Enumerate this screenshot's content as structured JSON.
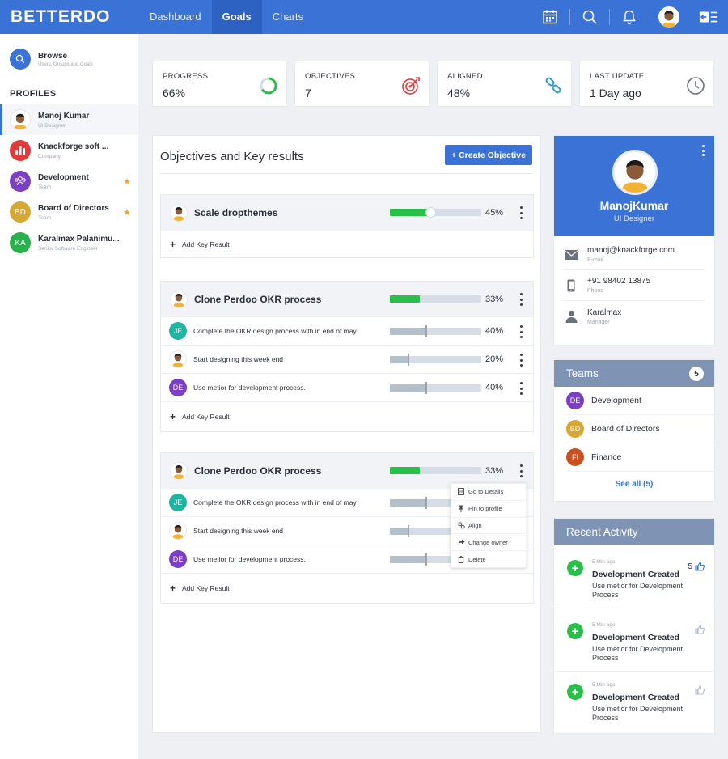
{
  "app": {
    "logo": "BETTERDO"
  },
  "nav": {
    "items": [
      {
        "label": "Dashboard"
      },
      {
        "label": "Goals"
      },
      {
        "label": "Charts"
      }
    ]
  },
  "sidebar": {
    "browse": {
      "title": "Browse",
      "subtitle": "Users, Groups and Goals"
    },
    "profiles_heading": "PROFILES",
    "profiles": [
      {
        "name": "Manoj Kumar",
        "sub": "UI Designer"
      },
      {
        "name": "Knackforge soft ...",
        "sub": "Company"
      },
      {
        "name": "Development",
        "sub": "Team"
      },
      {
        "name": "Board of Directors",
        "initials": "BD",
        "sub": "Team"
      },
      {
        "name": "Karalmax Palanimu...",
        "initials": "KA",
        "sub": "Senior Software Engineer"
      }
    ]
  },
  "stats": [
    {
      "label": "PROGRESS",
      "value": "66%"
    },
    {
      "label": "OBJECTIVES",
      "value": "7"
    },
    {
      "label": "ALIGNED",
      "value": "48%"
    },
    {
      "label": "LAST UPDATE",
      "value": "1 Day ago"
    }
  ],
  "objectives": {
    "title": "Objectives and Key results",
    "create_label": "+ Create Objective",
    "add_kr_label": "Add Key Result",
    "items": [
      {
        "name": "Scale dropthemes",
        "pct": "45%",
        "progress": 0.45,
        "key_results": []
      },
      {
        "name": "Clone Perdoo OKR process",
        "pct": "33%",
        "progress": 0.33,
        "key_results": [
          {
            "initials": "JE",
            "text": "Complete the OKR design process with in end of may",
            "pct": "40%",
            "progress": 0.4
          },
          {
            "initials": "",
            "text": "Start designing this week end",
            "pct": "20%",
            "progress": 0.2
          },
          {
            "initials": "DE",
            "text": "Use metior for development process.",
            "pct": "40%",
            "progress": 0.4
          }
        ]
      },
      {
        "name": "Clone Perdoo OKR process",
        "pct": "33%",
        "progress": 0.33,
        "key_results": [
          {
            "initials": "JE",
            "text": "Complete the OKR design process with in end of may",
            "progress": 0.4
          },
          {
            "initials": "",
            "text": "Start designing this week end",
            "progress": 0.2
          },
          {
            "initials": "DE",
            "text": "Use metior for development process.",
            "progress": 0.4
          }
        ]
      }
    ]
  },
  "context_menu": {
    "items": [
      "Go to Details",
      "Pin to profile",
      "Align",
      "Change owner",
      "Delete"
    ]
  },
  "profile_card": {
    "name": "ManojKumar",
    "role": "UI Designer",
    "email": "manoj@knackforge.com",
    "email_label": "E-mail",
    "phone": "+91 98402 13875",
    "phone_label": "Phone",
    "manager": "Karalmax",
    "manager_label": "Manager"
  },
  "teams": {
    "title": "Teams",
    "count": "5",
    "items": [
      {
        "initials": "DE",
        "name": "Development"
      },
      {
        "initials": "BD",
        "name": "Board of Directors"
      },
      {
        "initials": "FI",
        "name": "Finance"
      }
    ],
    "see_all": "See all (5)"
  },
  "recent_activity": {
    "title": "Recent Activity",
    "items": [
      {
        "time": "5 Min ago",
        "title": "Development Created",
        "desc": "Use metior for Development Process",
        "likes": "5"
      },
      {
        "time": "5 Min ago",
        "title": "Development Created",
        "desc": "Use metior for Development Process"
      },
      {
        "time": "5 Min ago",
        "title": "Development Created",
        "desc": "Use metior for Development Process"
      }
    ]
  },
  "colors": {
    "brand": "#3a72d6",
    "success": "#28c048",
    "teams_header": "#7f94b5",
    "star": "#f0a626"
  },
  "icons": {
    "calendar": "calendar-icon",
    "search": "search-icon",
    "bell": "bell-icon",
    "logout": "logout-icon"
  }
}
